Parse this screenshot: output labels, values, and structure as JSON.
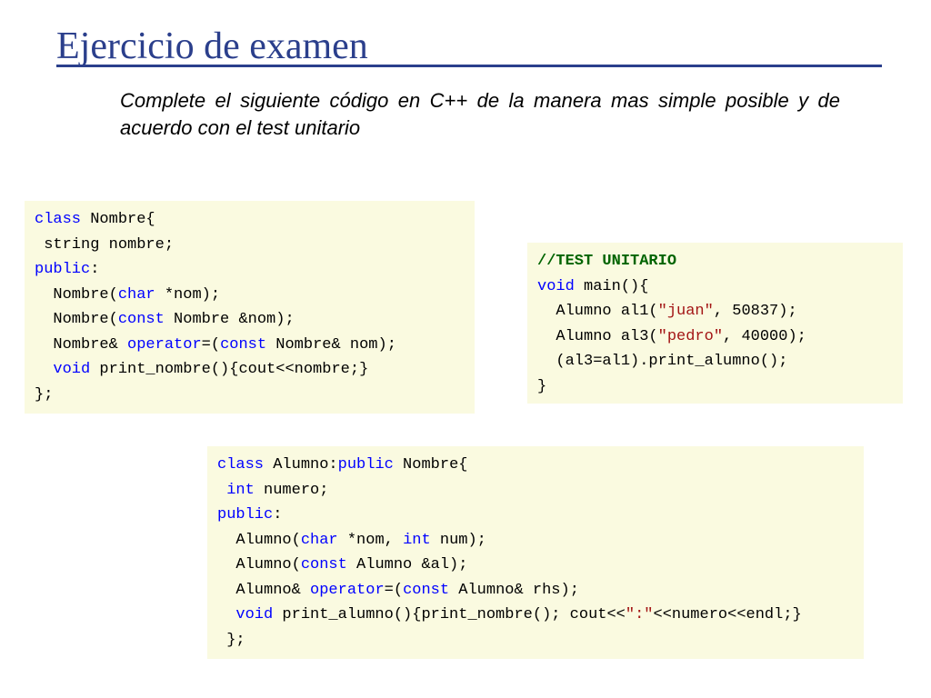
{
  "slide": {
    "title": "Ejercicio de examen",
    "instructions": "Complete el siguiente código en C++ de la manera mas simple posible y de acuerdo con el test unitario"
  },
  "code_blocks": [
    {
      "name": "nombre-class",
      "lines": [
        [
          {
            "t": "kw",
            "v": "class"
          },
          {
            "t": "plain",
            "v": " Nombre{"
          }
        ],
        [
          {
            "t": "plain",
            "v": " string nombre;"
          }
        ],
        [
          {
            "t": "kw",
            "v": "public"
          },
          {
            "t": "plain",
            "v": ":"
          }
        ],
        [
          {
            "t": "plain",
            "v": "  Nombre("
          },
          {
            "t": "kw",
            "v": "char"
          },
          {
            "t": "plain",
            "v": " *nom);"
          }
        ],
        [
          {
            "t": "plain",
            "v": "  Nombre("
          },
          {
            "t": "kw",
            "v": "const"
          },
          {
            "t": "plain",
            "v": " Nombre &nom);"
          }
        ],
        [
          {
            "t": "plain",
            "v": "  Nombre& "
          },
          {
            "t": "kw",
            "v": "operator"
          },
          {
            "t": "plain",
            "v": "=("
          },
          {
            "t": "kw",
            "v": "const"
          },
          {
            "t": "plain",
            "v": " Nombre& nom);"
          }
        ],
        [
          {
            "t": "plain",
            "v": "  "
          },
          {
            "t": "kw",
            "v": "void"
          },
          {
            "t": "plain",
            "v": " print_nombre(){cout<<nombre;}"
          }
        ],
        [
          {
            "t": "plain",
            "v": "};"
          }
        ]
      ]
    },
    {
      "name": "unit-test",
      "lines": [
        [
          {
            "t": "cmt",
            "v": "//TEST UNITARIO"
          }
        ],
        [
          {
            "t": "kw",
            "v": "void"
          },
          {
            "t": "plain",
            "v": " main(){"
          }
        ],
        [
          {
            "t": "plain",
            "v": "  Alumno al1("
          },
          {
            "t": "str",
            "v": "\"juan\""
          },
          {
            "t": "plain",
            "v": ", 50837);"
          }
        ],
        [
          {
            "t": "plain",
            "v": "  Alumno al3("
          },
          {
            "t": "str",
            "v": "\"pedro\""
          },
          {
            "t": "plain",
            "v": ", 40000);"
          }
        ],
        [
          {
            "t": "plain",
            "v": "  (al3=al1).print_alumno();"
          }
        ],
        [
          {
            "t": "plain",
            "v": "}"
          }
        ]
      ]
    },
    {
      "name": "alumno-class",
      "lines": [
        [
          {
            "t": "kw",
            "v": "class"
          },
          {
            "t": "plain",
            "v": " Alumno:"
          },
          {
            "t": "kw",
            "v": "public"
          },
          {
            "t": "plain",
            "v": " Nombre{"
          }
        ],
        [
          {
            "t": "plain",
            "v": " "
          },
          {
            "t": "kw",
            "v": "int"
          },
          {
            "t": "plain",
            "v": " numero;"
          }
        ],
        [
          {
            "t": "kw",
            "v": "public"
          },
          {
            "t": "plain",
            "v": ":"
          }
        ],
        [
          {
            "t": "plain",
            "v": "  Alumno("
          },
          {
            "t": "kw",
            "v": "char"
          },
          {
            "t": "plain",
            "v": " *nom, "
          },
          {
            "t": "kw",
            "v": "int"
          },
          {
            "t": "plain",
            "v": " num);"
          }
        ],
        [
          {
            "t": "plain",
            "v": "  Alumno("
          },
          {
            "t": "kw",
            "v": "const"
          },
          {
            "t": "plain",
            "v": " Alumno &al);"
          }
        ],
        [
          {
            "t": "plain",
            "v": "  Alumno& "
          },
          {
            "t": "kw",
            "v": "operator"
          },
          {
            "t": "plain",
            "v": "=("
          },
          {
            "t": "kw",
            "v": "const"
          },
          {
            "t": "plain",
            "v": " Alumno& rhs);"
          }
        ],
        [
          {
            "t": "plain",
            "v": "  "
          },
          {
            "t": "kw",
            "v": "void"
          },
          {
            "t": "plain",
            "v": " print_alumno(){print_nombre(); cout<<"
          },
          {
            "t": "str",
            "v": "\":\""
          },
          {
            "t": "plain",
            "v": "<<numero<<endl;}"
          }
        ],
        [
          {
            "t": "plain",
            "v": " };"
          }
        ]
      ]
    }
  ],
  "colors": {
    "title": "#2b3f8c",
    "code_background": "#fafae0",
    "keyword": "#0000ff",
    "string": "#a31515",
    "comment": "#006400"
  }
}
